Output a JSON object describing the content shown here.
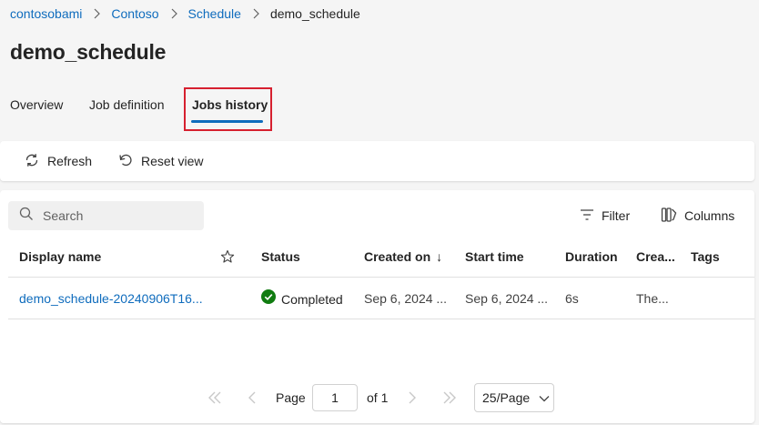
{
  "breadcrumb": {
    "items": [
      "contosobami",
      "Contoso",
      "Schedule"
    ],
    "current": "demo_schedule"
  },
  "page_title": "demo_schedule",
  "tabs": [
    {
      "label": "Overview"
    },
    {
      "label": "Job definition"
    },
    {
      "label": "Jobs history",
      "active": true
    }
  ],
  "toolbar": {
    "refresh_label": "Refresh",
    "reset_view_label": "Reset view"
  },
  "search": {
    "placeholder": "Search"
  },
  "grid_tools": {
    "filter_label": "Filter",
    "columns_label": "Columns"
  },
  "table": {
    "columns": [
      "Display name",
      "Status",
      "Created on",
      "Start time",
      "Duration",
      "Crea...",
      "Tags"
    ],
    "sort_indicator": "↓",
    "rows": [
      {
        "display_name": "demo_schedule-20240906T16...",
        "status": "Completed",
        "created_on": "Sep 6, 2024 ...",
        "start_time": "Sep 6, 2024 ...",
        "duration": "6s",
        "created_by": "The...",
        "tags": ""
      }
    ]
  },
  "pagination": {
    "page_label": "Page",
    "current_page": "1",
    "of_label": "of 1",
    "page_size": "25/Page"
  },
  "colors": {
    "link": "#0f6cbd",
    "success": "#107c10",
    "highlight_border": "#d6202f"
  }
}
